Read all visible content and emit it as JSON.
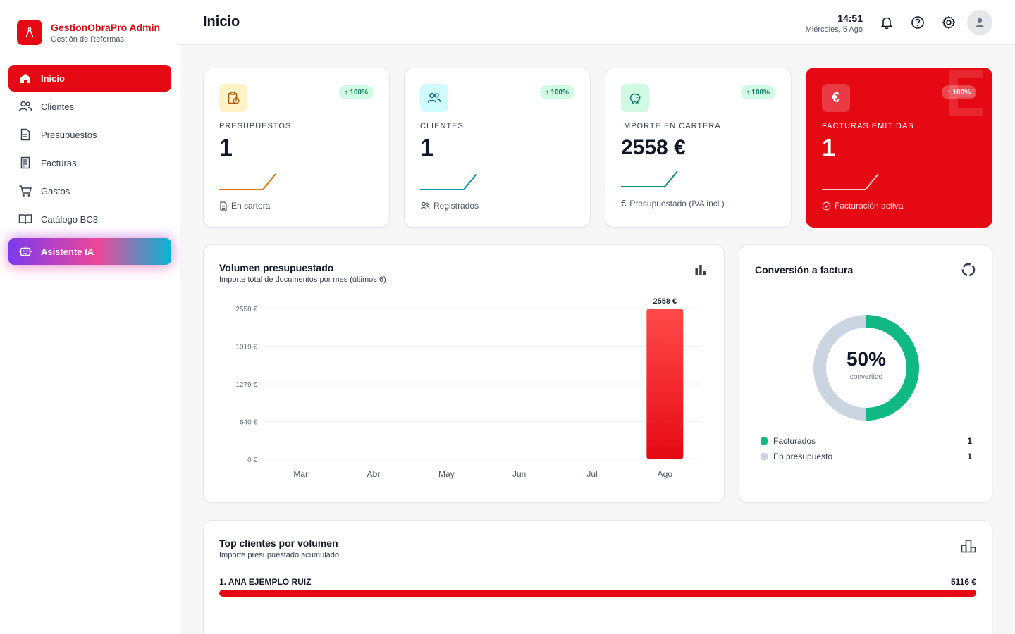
{
  "brand": {
    "title": "GestionObraPro Admin",
    "subtitle": "Gestión de Reformas"
  },
  "nav": [
    {
      "label": "Inicio",
      "icon": "home-icon",
      "active": true
    },
    {
      "label": "Clientes",
      "icon": "users-icon"
    },
    {
      "label": "Presupuestos",
      "icon": "document-icon"
    },
    {
      "label": "Facturas",
      "icon": "receipt-icon"
    },
    {
      "label": "Gastos",
      "icon": "cart-icon"
    },
    {
      "label": "Catálogo BC3",
      "icon": "book-icon"
    },
    {
      "label": "Asistente IA",
      "icon": "robot-icon"
    }
  ],
  "header": {
    "title": "Inicio",
    "time": "14:51",
    "date": "Miércoles, 5 Ago"
  },
  "stats": [
    {
      "label": "PRESUPUESTOS",
      "value": "1",
      "badge": "↑ 100%",
      "footer": "En cartera",
      "color": "#d97706"
    },
    {
      "label": "CLIENTES",
      "value": "1",
      "badge": "↑ 100%",
      "footer": "Registrados",
      "color": "#0891b2"
    },
    {
      "label": "IMPORTE EN CARTERA",
      "value": "2558 €",
      "badge": "↑ 100%",
      "footer": "Presupuestado (IVA incl.)",
      "color": "#059669"
    },
    {
      "label": "FACTURAS EMITIDAS",
      "value": "1",
      "badge": "↑ 100%",
      "footer": "Facturación activa",
      "color": "#ffffff"
    }
  ],
  "volume": {
    "title": "Volumen presupuestado",
    "subtitle": "Importe total de documentos por mes (últimos 6)"
  },
  "chart_data": {
    "type": "bar",
    "categories": [
      "Mar",
      "Abr",
      "May",
      "Jun",
      "Jul",
      "Ago"
    ],
    "values": [
      0,
      0,
      0,
      0,
      0,
      2558
    ],
    "value_labels": [
      "",
      "",
      "",
      "",
      "",
      "2558 €"
    ],
    "yticks": [
      "0 €",
      "640 €",
      "1279 €",
      "1919 €",
      "2558 €"
    ],
    "ylim": [
      0,
      2558
    ],
    "grid": true,
    "bar_color": "#e50914"
  },
  "conversion": {
    "title": "Conversión a factura",
    "percent": "50%",
    "caption": "convertido",
    "fraction": 0.5,
    "legend": [
      {
        "label": "Facturados",
        "value": "1",
        "color": "#10b981"
      },
      {
        "label": "En presupuesto",
        "value": "1",
        "color": "#cbd5e1"
      }
    ]
  },
  "top_clients": {
    "title": "Top clientes por volumen",
    "subtitle": "Importe presupuestado acumulado",
    "items": [
      {
        "name": "1. ANA EJEMPLO RUIZ",
        "amount": "5116 €",
        "fraction": 1.0
      }
    ]
  }
}
